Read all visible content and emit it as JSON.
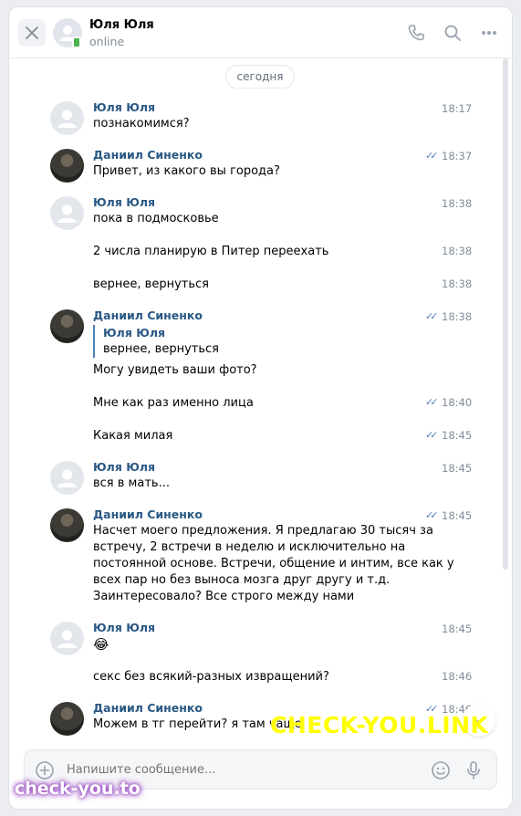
{
  "header": {
    "contact_name": "Юля Юля",
    "status": "online"
  },
  "date_divider": "сегодня",
  "messages": [
    {
      "sender": "Юля Юля",
      "text": "познакомимся?",
      "time": "18:17"
    },
    {
      "sender": "Даниил Синенко",
      "text": "Привет, из какого вы города?",
      "time": "18:37",
      "read": true
    },
    {
      "sender": "Юля Юля",
      "text": "пока в подмосковье",
      "time": "18:38"
    },
    {
      "text": "2 числа планирую в Питер переехать",
      "time": "18:38"
    },
    {
      "text": "вернее, вернуться",
      "time": "18:38"
    },
    {
      "sender": "Даниил Синенко",
      "quote_name": "Юля Юля",
      "quote_text": "вернее, вернуться",
      "text": "Могу увидеть ваши фото?",
      "time": "18:38",
      "read": true
    },
    {
      "text": "Мне как раз именно лица",
      "time": "18:40",
      "read": true
    },
    {
      "text": "Какая милая",
      "time": "18:45",
      "read": true
    },
    {
      "sender": "Юля Юля",
      "text": "вся в мать...",
      "time": "18:45"
    },
    {
      "sender": "Даниил Синенко",
      "lines": [
        "Насчет моего предложения. Я предлагаю 30 тысяч за",
        "встречу, 2 встречи в неделю и исключительно на",
        "постоянной основе. Встречи, общение и интим, все как у",
        "всех пар но без выноса мозга друг другу и т.д.",
        "Заинтересовало? Все строго между нами"
      ],
      "time": "18:45",
      "read": true
    },
    {
      "sender": "Юля Юля",
      "text": "😂",
      "time": "18:45"
    },
    {
      "text": "секс без всякий-разных извращений?",
      "time": "18:46"
    },
    {
      "sender": "Даниил Синенко",
      "text": "Можем в тг перейти? я там чаще",
      "time": "18:46",
      "read": true
    }
  ],
  "composer": {
    "placeholder": "Напишите сообщение..."
  },
  "watermarks": {
    "link": "CHECK-YOU.LINK",
    "to": "check-you.to"
  },
  "colors": {
    "accent": "#2a5885",
    "read_check": "#5181b8",
    "online": "#4bb34b"
  }
}
